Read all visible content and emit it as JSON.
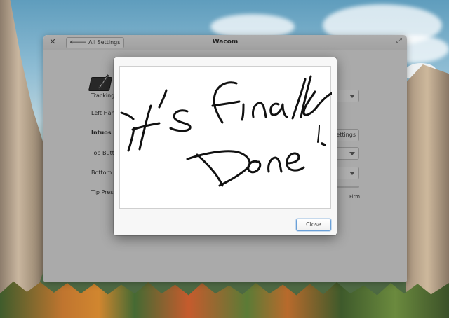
{
  "window": {
    "title": "Wacom",
    "back_button_label": "All Settings",
    "close_icon": "close-icon",
    "maximize_icon": "maximize-icon"
  },
  "settings": {
    "tracking_label": "Tracking",
    "left_handed_label": "Left Hand",
    "stylus_section_label": "Intuos Pe",
    "map_buttons_label": "Settings",
    "top_button_label": "Top Butto",
    "bottom_button_label": "Bottom B",
    "tip_pressure_label": "Tip Press",
    "tip_pressure_max_label": "Firm"
  },
  "dialog": {
    "close_button_label": "Close",
    "handwriting_text": "It's finally Done."
  },
  "colors": {
    "accent_border": "#6aa0d8",
    "overlay": "rgba(0,0,0,0.30)"
  }
}
